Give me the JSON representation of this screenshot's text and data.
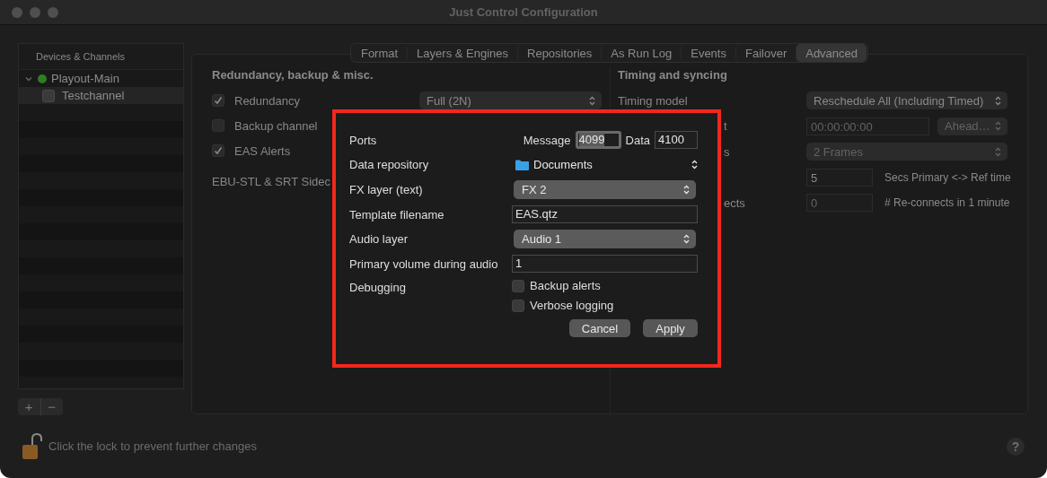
{
  "window": {
    "title": "Just Control Configuration"
  },
  "sidebar": {
    "header": "Devices & Channels",
    "tree": [
      {
        "label": "Playout-Main",
        "expanded": true,
        "selected": false,
        "color": "#2f7d24",
        "children": [
          {
            "label": "Testchannel",
            "selected": true
          }
        ]
      }
    ],
    "buttons": [
      "+",
      "−"
    ]
  },
  "tabs": [
    {
      "label": "Format",
      "selected": false
    },
    {
      "label": "Layers & Engines",
      "selected": false
    },
    {
      "label": "Repositories",
      "selected": false
    },
    {
      "label": "As Run Log",
      "selected": false
    },
    {
      "label": "Events",
      "selected": false
    },
    {
      "label": "Failover",
      "selected": false
    },
    {
      "label": "Advanced",
      "selected": true
    }
  ],
  "redundancy_section": {
    "title": "Redundancy, backup & misc.",
    "rows": [
      {
        "kind": "checkbox",
        "label": "Redundancy",
        "checked": true,
        "popup": "Full (2N)"
      },
      {
        "kind": "checkbox",
        "label": "Backup channel",
        "checked": false
      },
      {
        "kind": "checkbox",
        "label": "EAS Alerts",
        "checked": true
      },
      {
        "kind": "text",
        "label": "EBU-STL & SRT Sidec"
      }
    ]
  },
  "timing_section": {
    "title": "Timing and syncing",
    "rows": [
      {
        "kind": "popup",
        "label": "Timing model",
        "value": "Reschedule All (Including Timed)",
        "disabled": false
      },
      {
        "kind": "field_popup",
        "label": "t",
        "value": "00:00:00:00",
        "popup": "Ahead…",
        "disabled": true
      },
      {
        "kind": "popup",
        "label": "s",
        "value": "2 Frames",
        "disabled": true
      },
      {
        "kind": "field",
        "value": "5",
        "note": "Secs Primary <-> Ref time",
        "disabled": false
      },
      {
        "kind": "field",
        "label": "ects",
        "value": "0",
        "note": "# Re-connects in 1 minute",
        "disabled": true
      }
    ]
  },
  "dialog": {
    "rows": [
      {
        "kind": "ports",
        "label": "Ports",
        "message_label": "Message",
        "message": "4099",
        "message_focused": true,
        "data_label": "Data",
        "data": "4100"
      },
      {
        "kind": "folder_popup",
        "label": "Data repository",
        "value": "Documents"
      },
      {
        "kind": "popup",
        "label": "FX layer (text)",
        "value": "FX 2"
      },
      {
        "kind": "field",
        "label": "Template filename",
        "value": "EAS.qtz"
      },
      {
        "kind": "popup",
        "label": "Audio layer",
        "value": "Audio 1"
      },
      {
        "kind": "field",
        "label": "Primary volume during audio",
        "value": "1"
      },
      {
        "kind": "checkboxes",
        "label": "Debugging",
        "options": [
          {
            "label": "Backup alerts",
            "checked": false
          },
          {
            "label": "Verbose logging",
            "checked": false
          }
        ]
      }
    ],
    "buttons": [
      {
        "label": "Cancel"
      },
      {
        "label": "Apply"
      }
    ]
  },
  "footer": {
    "lock_text": "Click the lock to prevent further changes",
    "help": "?"
  }
}
